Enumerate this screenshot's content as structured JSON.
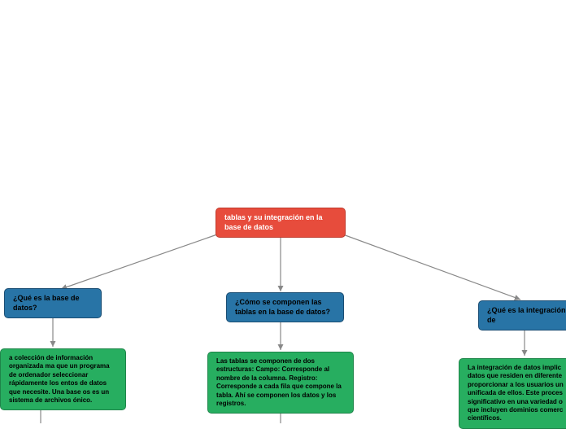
{
  "root": {
    "title": "tablas y su integración en la base de datos"
  },
  "level1": {
    "q1": "¿Qué es la base de datos?",
    "q2": "¿Cómo se componen las tablas en la base de datos?",
    "q3": "¿Qué es la integración de"
  },
  "level2": {
    "a1": "a colección de información organizada ma que un programa de ordenador seleccionar rápidamente los entos de datos que necesite. Una base os es un sistema de archivos ónico.",
    "a2": "Las tablas se componen de dos estructuras: Campo: Corresponde al nombre de la columna. Registro: Corresponde a cada fila que compone la tabla. Ahí se componen los datos y los registros.",
    "a3": "La integración de datos implic datos que residen en diferente proporcionar a los usuarios un unificada de ellos. Este proces significativo en una variedad o que incluyen dominios comerc científicos."
  },
  "chart_data": {
    "type": "diagram",
    "title": "tablas y su integración en la base de datos",
    "nodes": [
      {
        "id": "root",
        "label": "tablas y su integración en la base de datos",
        "color": "#e74c3c"
      },
      {
        "id": "q1",
        "label": "¿Qué es la base de datos?",
        "color": "#2874a6",
        "parent": "root"
      },
      {
        "id": "q2",
        "label": "¿Cómo se componen las tablas en la base de datos?",
        "color": "#2874a6",
        "parent": "root"
      },
      {
        "id": "q3",
        "label": "¿Qué es la integración de",
        "color": "#2874a6",
        "parent": "root"
      },
      {
        "id": "a1",
        "label": "a colección de información organizada ma que un programa de ordenador seleccionar rápidamente los entos de datos que necesite. Una base os es un sistema de archivos ónico.",
        "color": "#27ae60",
        "parent": "q1"
      },
      {
        "id": "a2",
        "label": "Las tablas se componen de dos estructuras: Campo: Corresponde al nombre de la columna. Registro: Corresponde a cada fila que compone la tabla. Ahí se componen los datos y los registros.",
        "color": "#27ae60",
        "parent": "q2"
      },
      {
        "id": "a3",
        "label": "La integración de datos implic datos que residen en diferente proporcionar a los usuarios un unificada de ellos. Este proces significativo en una variedad o que incluyen dominios comerc científicos.",
        "color": "#27ae60",
        "parent": "q3"
      }
    ]
  }
}
